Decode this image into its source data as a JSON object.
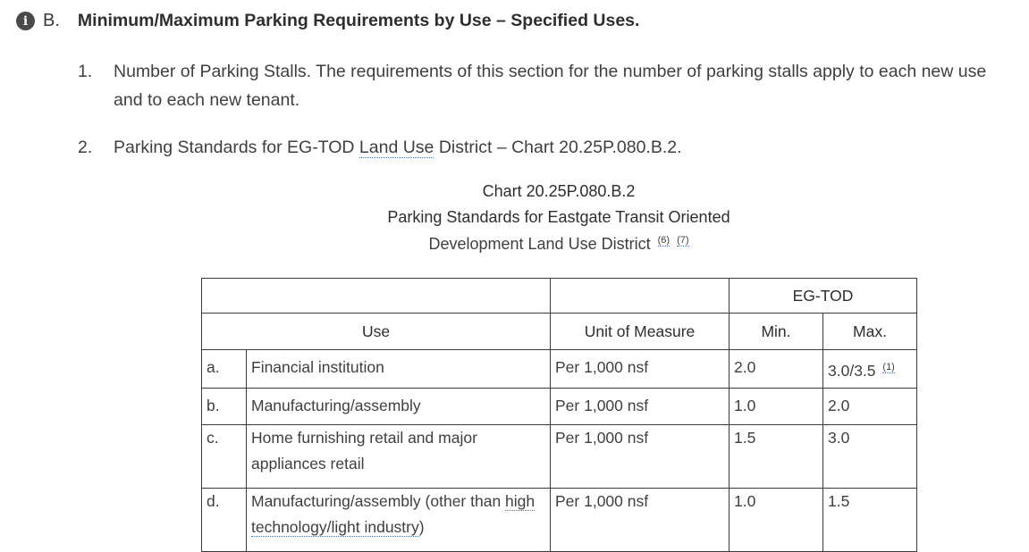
{
  "section": {
    "letter": "B.",
    "title": "Minimum/Maximum Parking Requirements by Use – Specified Uses.",
    "icon": "info-icon"
  },
  "items": [
    {
      "num": "1.",
      "text": "Number of Parking Stalls. The requirements of this section for the number of parking stalls apply to each new use and to each new tenant."
    },
    {
      "num": "2.",
      "text_before": "Parking Standards for EG-TOD ",
      "link": "Land Use",
      "text_after": " District – Chart 20.25P.080.B.2."
    }
  ],
  "chart": {
    "title_line1": "Chart 20.25P.080.B.2",
    "title_line2": "Parking Standards for Eastgate Transit Oriented",
    "title_line3": "Development Land Use District",
    "footnotes": [
      "(6)",
      "(7)"
    ]
  },
  "table": {
    "group_header": "EG-TOD",
    "headers": {
      "use": "Use",
      "unit": "Unit of Measure",
      "min": "Min.",
      "max": "Max."
    },
    "rows": [
      {
        "letter": "a.",
        "use": "Financial institution",
        "unit": "Per 1,000 nsf",
        "min": "2.0",
        "max": "3.0/3.5",
        "max_fn": "(1)"
      },
      {
        "letter": "b.",
        "use": "Manufacturing/assembly",
        "unit": "Per 1,000 nsf",
        "min": "1.0",
        "max": "2.0"
      },
      {
        "letter": "c.",
        "use": "Home furnishing retail and major appliances retail",
        "unit": "Per 1,000 nsf",
        "min": "1.5",
        "max": "3.0"
      },
      {
        "letter": "d.",
        "use_before": "Manufacturing/assembly (other than ",
        "use_link": "high technology/light industry",
        "use_after": ")",
        "unit": "Per 1,000 nsf",
        "min": "1.0",
        "max": "1.5"
      }
    ]
  }
}
